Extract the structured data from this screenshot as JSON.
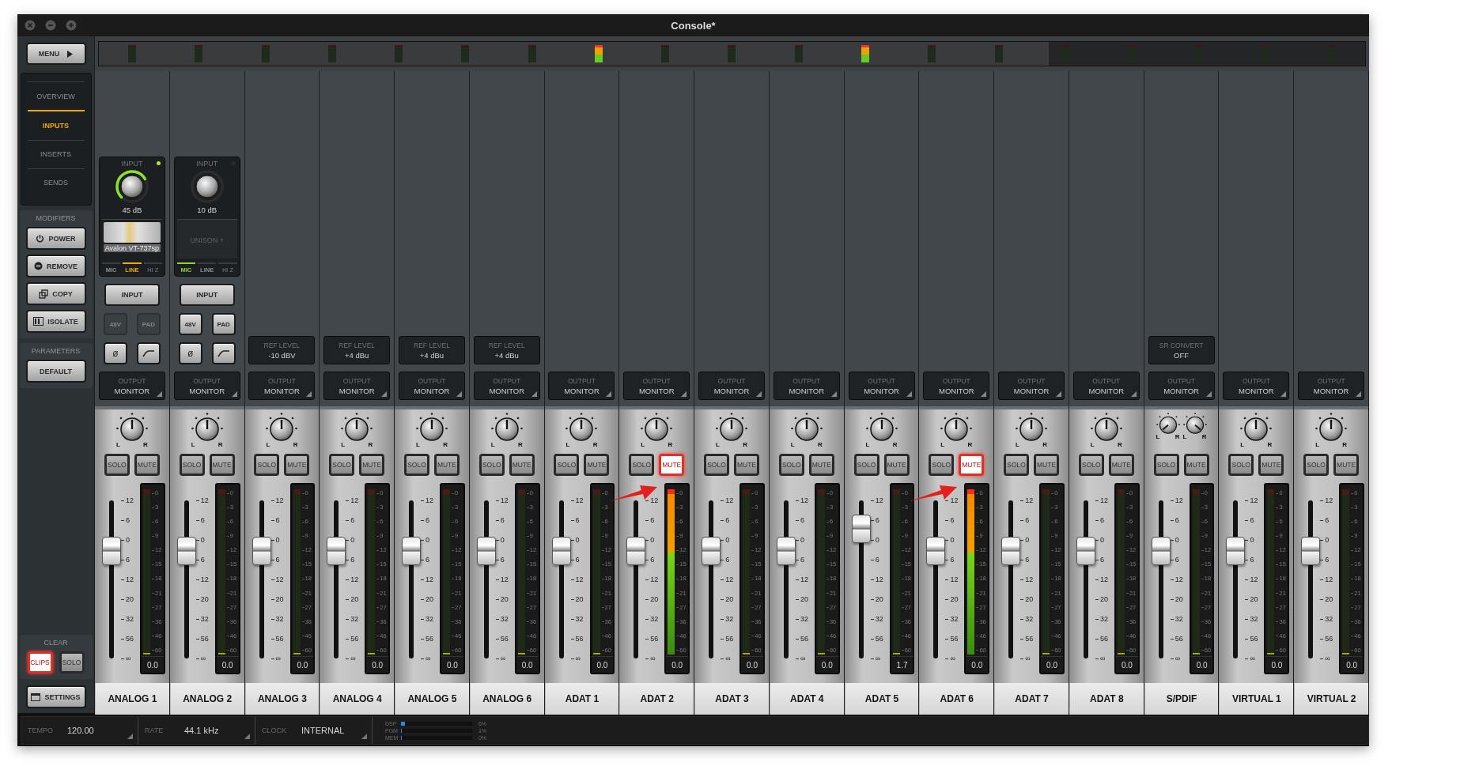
{
  "window": {
    "title": "Console*"
  },
  "overview": {
    "meters": [
      {
        "signal": false
      },
      {
        "signal": false
      },
      {
        "signal": false
      },
      {
        "signal": false
      },
      {
        "signal": false
      },
      {
        "signal": false
      },
      {
        "signal": false
      },
      {
        "signal": true
      },
      {
        "signal": false
      },
      {
        "signal": false
      },
      {
        "signal": false
      },
      {
        "signal": true
      },
      {
        "signal": false
      },
      {
        "signal": false
      },
      {
        "signal": false
      },
      {
        "signal": false
      },
      {
        "signal": false
      },
      {
        "signal": false
      },
      {
        "signal": false
      }
    ]
  },
  "sidebar": {
    "menu": "MENU",
    "nav": [
      {
        "label": "OVERVIEW",
        "selected": false
      },
      {
        "label": "INPUTS",
        "selected": true
      },
      {
        "label": "INSERTS",
        "selected": false
      },
      {
        "label": "SENDS",
        "selected": false
      }
    ],
    "modifiers_title": "MODIFIERS",
    "modifiers": [
      {
        "label": "POWER",
        "kind": "power"
      },
      {
        "label": "REMOVE",
        "kind": "remove"
      },
      {
        "label": "COPY",
        "kind": "copy"
      },
      {
        "label": "ISOLATE",
        "kind": "isolate"
      }
    ],
    "parameters_title": "PARAMETERS",
    "default": "DEFAULT",
    "clear_title": "CLEAR",
    "clear": [
      {
        "label": "CLIPS",
        "selected": true
      },
      {
        "label": "SOLO",
        "selected": false
      }
    ],
    "settings": "SETTINGS"
  },
  "channels": [
    {
      "name": "ANALOG 1",
      "input": {
        "title": "INPUT",
        "ring_lit": true,
        "led_on": true,
        "gain": "45 dB",
        "unison": {
          "kind": "loaded",
          "label": "Avalon VT-737sp"
        },
        "sources": [
          {
            "label": "MIC",
            "kind": "mic",
            "selected": false,
            "disabled": false
          },
          {
            "label": "LINE",
            "kind": "line",
            "selected": true,
            "disabled": false
          },
          {
            "label": "HI Z",
            "kind": "hiz",
            "selected": false,
            "disabled": true
          }
        ],
        "input_button": "INPUT",
        "phantom": {
          "label": "48V",
          "disabled": true
        },
        "pad": {
          "label": "PAD",
          "disabled": true
        },
        "phase": "ø"
      },
      "output": {
        "label": "OUTPUT",
        "value": "MONITOR"
      },
      "pans": [
        {
          "left": "L",
          "right": "R",
          "kind": "center"
        }
      ],
      "solo": {
        "label": "SOLO",
        "selected": false
      },
      "mute": {
        "label": "MUTE",
        "selected": false
      },
      "fader": {
        "level": 0.68
      },
      "fader_scale": [
        "12",
        "6",
        "0",
        "6",
        "12",
        "20",
        "32",
        "56",
        "∞"
      ],
      "meter": {
        "level": 0,
        "clip": false,
        "reading": "0.0"
      },
      "meter_scale": [
        "0",
        "3",
        "6",
        "9",
        "12",
        "15",
        "18",
        "21",
        "27",
        "36",
        "46",
        "60"
      ],
      "arrow": false
    },
    {
      "name": "ANALOG 2",
      "input": {
        "title": "INPUT",
        "ring_lit": false,
        "led_on": false,
        "gain": "10 dB",
        "unison": {
          "kind": "empty",
          "label": "UNISON +"
        },
        "sources": [
          {
            "label": "MIC",
            "kind": "mic",
            "selected": true,
            "disabled": false
          },
          {
            "label": "LINE",
            "kind": "line",
            "selected": false,
            "disabled": false
          },
          {
            "label": "HI Z",
            "kind": "hiz",
            "selected": false,
            "disabled": true
          }
        ],
        "input_button": "INPUT",
        "phantom": {
          "label": "48V",
          "disabled": false
        },
        "pad": {
          "label": "PAD",
          "disabled": false
        },
        "phase": "ø"
      },
      "output": {
        "label": "OUTPUT",
        "value": "MONITOR"
      },
      "pans": [
        {
          "left": "L",
          "right": "R",
          "kind": "center"
        }
      ],
      "solo": {
        "label": "SOLO",
        "selected": false
      },
      "mute": {
        "label": "MUTE",
        "selected": false
      },
      "fader": {
        "level": 0.68
      },
      "fader_scale": [
        "12",
        "6",
        "0",
        "6",
        "12",
        "20",
        "32",
        "56",
        "∞"
      ],
      "meter": {
        "level": 0,
        "clip": false,
        "reading": "0.0"
      },
      "meter_scale": [
        "0",
        "3",
        "6",
        "9",
        "12",
        "15",
        "18",
        "21",
        "27",
        "36",
        "46",
        "60"
      ],
      "arrow": false
    },
    {
      "name": "ANALOG 3",
      "setting": {
        "label": "REF LEVEL",
        "value": "-10 dBV"
      },
      "output": {
        "label": "OUTPUT",
        "value": "MONITOR"
      },
      "pans": [
        {
          "left": "L",
          "right": "R",
          "kind": "center"
        }
      ],
      "solo": {
        "label": "SOLO",
        "selected": false
      },
      "mute": {
        "label": "MUTE",
        "selected": false
      },
      "fader": {
        "level": 0.68
      },
      "fader_scale": [
        "12",
        "6",
        "0",
        "6",
        "12",
        "20",
        "32",
        "56",
        "∞"
      ],
      "meter": {
        "level": 0,
        "clip": false,
        "reading": "0.0"
      },
      "meter_scale": [
        "0",
        "3",
        "6",
        "9",
        "12",
        "15",
        "18",
        "21",
        "27",
        "36",
        "46",
        "60"
      ],
      "arrow": false
    },
    {
      "name": "ANALOG 4",
      "setting": {
        "label": "REF LEVEL",
        "value": "+4 dBu"
      },
      "output": {
        "label": "OUTPUT",
        "value": "MONITOR"
      },
      "pans": [
        {
          "left": "L",
          "right": "R",
          "kind": "center"
        }
      ],
      "solo": {
        "label": "SOLO",
        "selected": false
      },
      "mute": {
        "label": "MUTE",
        "selected": false
      },
      "fader": {
        "level": 0.68
      },
      "fader_scale": [
        "12",
        "6",
        "0",
        "6",
        "12",
        "20",
        "32",
        "56",
        "∞"
      ],
      "meter": {
        "level": 0,
        "clip": false,
        "reading": "0.0"
      },
      "meter_scale": [
        "0",
        "3",
        "6",
        "9",
        "12",
        "15",
        "18",
        "21",
        "27",
        "36",
        "46",
        "60"
      ],
      "arrow": false
    },
    {
      "name": "ANALOG 5",
      "setting": {
        "label": "REF LEVEL",
        "value": "+4 dBu"
      },
      "output": {
        "label": "OUTPUT",
        "value": "MONITOR"
      },
      "pans": [
        {
          "left": "L",
          "right": "R",
          "kind": "center"
        }
      ],
      "solo": {
        "label": "SOLO",
        "selected": false
      },
      "mute": {
        "label": "MUTE",
        "selected": false
      },
      "fader": {
        "level": 0.68
      },
      "fader_scale": [
        "12",
        "6",
        "0",
        "6",
        "12",
        "20",
        "32",
        "56",
        "∞"
      ],
      "meter": {
        "level": 0,
        "clip": false,
        "reading": "0.0"
      },
      "meter_scale": [
        "0",
        "3",
        "6",
        "9",
        "12",
        "15",
        "18",
        "21",
        "27",
        "36",
        "46",
        "60"
      ],
      "arrow": false
    },
    {
      "name": "ANALOG 6",
      "setting": {
        "label": "REF LEVEL",
        "value": "+4 dBu"
      },
      "output": {
        "label": "OUTPUT",
        "value": "MONITOR"
      },
      "pans": [
        {
          "left": "L",
          "right": "R",
          "kind": "center"
        }
      ],
      "solo": {
        "label": "SOLO",
        "selected": false
      },
      "mute": {
        "label": "MUTE",
        "selected": false
      },
      "fader": {
        "level": 0.68
      },
      "fader_scale": [
        "12",
        "6",
        "0",
        "6",
        "12",
        "20",
        "32",
        "56",
        "∞"
      ],
      "meter": {
        "level": 0,
        "clip": false,
        "reading": "0.0"
      },
      "meter_scale": [
        "0",
        "3",
        "6",
        "9",
        "12",
        "15",
        "18",
        "21",
        "27",
        "36",
        "46",
        "60"
      ],
      "arrow": false
    },
    {
      "name": "ADAT 1",
      "output": {
        "label": "OUTPUT",
        "value": "MONITOR"
      },
      "pans": [
        {
          "left": "L",
          "right": "R",
          "kind": "center"
        }
      ],
      "solo": {
        "label": "SOLO",
        "selected": false
      },
      "mute": {
        "label": "MUTE",
        "selected": false
      },
      "fader": {
        "level": 0.68
      },
      "fader_scale": [
        "12",
        "6",
        "0",
        "6",
        "12",
        "20",
        "32",
        "56",
        "∞"
      ],
      "meter": {
        "level": 0,
        "clip": false,
        "reading": "0.0"
      },
      "meter_scale": [
        "0",
        "3",
        "6",
        "9",
        "12",
        "15",
        "18",
        "21",
        "27",
        "36",
        "46",
        "60"
      ],
      "arrow": false
    },
    {
      "name": "ADAT 2",
      "output": {
        "label": "OUTPUT",
        "value": "MONITOR"
      },
      "pans": [
        {
          "left": "L",
          "right": "R",
          "kind": "center"
        }
      ],
      "solo": {
        "label": "SOLO",
        "selected": false
      },
      "mute": {
        "label": "MUTE",
        "selected": true
      },
      "fader": {
        "level": 0.68
      },
      "fader_scale": [
        "12",
        "6",
        "0",
        "6",
        "12",
        "20",
        "32",
        "56",
        "∞"
      ],
      "meter": {
        "level": 0.98,
        "clip": true,
        "reading": "0.0"
      },
      "meter_scale": [
        "0",
        "3",
        "6",
        "9",
        "12",
        "15",
        "18",
        "21",
        "27",
        "36",
        "46",
        "60"
      ],
      "arrow": true
    },
    {
      "name": "ADAT 3",
      "output": {
        "label": "OUTPUT",
        "value": "MONITOR"
      },
      "pans": [
        {
          "left": "L",
          "right": "R",
          "kind": "center"
        }
      ],
      "solo": {
        "label": "SOLO",
        "selected": false
      },
      "mute": {
        "label": "MUTE",
        "selected": false
      },
      "fader": {
        "level": 0.68
      },
      "fader_scale": [
        "12",
        "6",
        "0",
        "6",
        "12",
        "20",
        "32",
        "56",
        "∞"
      ],
      "meter": {
        "level": 0,
        "clip": false,
        "reading": "0.0"
      },
      "meter_scale": [
        "0",
        "3",
        "6",
        "9",
        "12",
        "15",
        "18",
        "21",
        "27",
        "36",
        "46",
        "60"
      ],
      "arrow": false
    },
    {
      "name": "ADAT 4",
      "output": {
        "label": "OUTPUT",
        "value": "MONITOR"
      },
      "pans": [
        {
          "left": "L",
          "right": "R",
          "kind": "center"
        }
      ],
      "solo": {
        "label": "SOLO",
        "selected": false
      },
      "mute": {
        "label": "MUTE",
        "selected": false
      },
      "fader": {
        "level": 0.68
      },
      "fader_scale": [
        "12",
        "6",
        "0",
        "6",
        "12",
        "20",
        "32",
        "56",
        "∞"
      ],
      "meter": {
        "level": 0,
        "clip": false,
        "reading": "0.0"
      },
      "meter_scale": [
        "0",
        "3",
        "6",
        "9",
        "12",
        "15",
        "18",
        "21",
        "27",
        "36",
        "46",
        "60"
      ],
      "arrow": false
    },
    {
      "name": "ADAT 5",
      "output": {
        "label": "OUTPUT",
        "value": "MONITOR"
      },
      "pans": [
        {
          "left": "L",
          "right": "R",
          "kind": "center"
        }
      ],
      "solo": {
        "label": "SOLO",
        "selected": false
      },
      "mute": {
        "label": "MUTE",
        "selected": false
      },
      "fader": {
        "level": 0.82
      },
      "fader_scale": [
        "12",
        "6",
        "0",
        "6",
        "12",
        "20",
        "32",
        "56",
        "∞"
      ],
      "meter": {
        "level": 0,
        "clip": false,
        "reading": "1.7"
      },
      "meter_scale": [
        "0",
        "3",
        "6",
        "9",
        "12",
        "15",
        "18",
        "21",
        "27",
        "36",
        "46",
        "60"
      ],
      "arrow": false
    },
    {
      "name": "ADAT 6",
      "output": {
        "label": "OUTPUT",
        "value": "MONITOR"
      },
      "pans": [
        {
          "left": "L",
          "right": "R",
          "kind": "center"
        }
      ],
      "solo": {
        "label": "SOLO",
        "selected": false
      },
      "mute": {
        "label": "MUTE",
        "selected": true
      },
      "fader": {
        "level": 0.68
      },
      "fader_scale": [
        "12",
        "6",
        "0",
        "6",
        "12",
        "20",
        "32",
        "56",
        "∞"
      ],
      "meter": {
        "level": 0.98,
        "clip": true,
        "reading": "0.0"
      },
      "meter_scale": [
        "0",
        "3",
        "6",
        "9",
        "12",
        "15",
        "18",
        "21",
        "27",
        "36",
        "46",
        "60"
      ],
      "arrow": true
    },
    {
      "name": "ADAT 7",
      "output": {
        "label": "OUTPUT",
        "value": "MONITOR"
      },
      "pans": [
        {
          "left": "L",
          "right": "R",
          "kind": "center"
        }
      ],
      "solo": {
        "label": "SOLO",
        "selected": false
      },
      "mute": {
        "label": "MUTE",
        "selected": false
      },
      "fader": {
        "level": 0.68
      },
      "fader_scale": [
        "12",
        "6",
        "0",
        "6",
        "12",
        "20",
        "32",
        "56",
        "∞"
      ],
      "meter": {
        "level": 0,
        "clip": false,
        "reading": "0.0"
      },
      "meter_scale": [
        "0",
        "3",
        "6",
        "9",
        "12",
        "15",
        "18",
        "21",
        "27",
        "36",
        "46",
        "60"
      ],
      "arrow": false
    },
    {
      "name": "ADAT 8",
      "output": {
        "label": "OUTPUT",
        "value": "MONITOR"
      },
      "pans": [
        {
          "left": "L",
          "right": "R",
          "kind": "center"
        }
      ],
      "solo": {
        "label": "SOLO",
        "selected": false
      },
      "mute": {
        "label": "MUTE",
        "selected": false
      },
      "fader": {
        "level": 0.68
      },
      "fader_scale": [
        "12",
        "6",
        "0",
        "6",
        "12",
        "20",
        "32",
        "56",
        "∞"
      ],
      "meter": {
        "level": 0,
        "clip": false,
        "reading": "0.0"
      },
      "meter_scale": [
        "0",
        "3",
        "6",
        "9",
        "12",
        "15",
        "18",
        "21",
        "27",
        "36",
        "46",
        "60"
      ],
      "arrow": false
    },
    {
      "name": "S/PDIF",
      "setting": {
        "label": "SR CONVERT",
        "value": "OFF"
      },
      "output": {
        "label": "OUTPUT",
        "value": "MONITOR"
      },
      "pans": [
        {
          "left": "L",
          "right": "R",
          "kind": "left"
        },
        {
          "left": "L",
          "right": "R",
          "kind": "right"
        }
      ],
      "solo": {
        "label": "SOLO",
        "selected": false
      },
      "mute": {
        "label": "MUTE",
        "selected": false
      },
      "fader": {
        "level": 0.68
      },
      "fader_scale": [
        "12",
        "6",
        "0",
        "6",
        "12",
        "20",
        "32",
        "56",
        "∞"
      ],
      "meter": {
        "level": 0,
        "clip": false,
        "reading": "0.0"
      },
      "meter_scale": [
        "0",
        "3",
        "6",
        "9",
        "12",
        "15",
        "18",
        "21",
        "27",
        "36",
        "46",
        "60"
      ],
      "arrow": false
    },
    {
      "name": "VIRTUAL 1",
      "output": {
        "label": "OUTPUT",
        "value": "MONITOR"
      },
      "pans": [
        {
          "left": "L",
          "right": "R",
          "kind": "center"
        }
      ],
      "solo": {
        "label": "SOLO",
        "selected": false
      },
      "mute": {
        "label": "MUTE",
        "selected": false
      },
      "fader": {
        "level": 0.68
      },
      "fader_scale": [
        "12",
        "6",
        "0",
        "6",
        "12",
        "20",
        "32",
        "56",
        "∞"
      ],
      "meter": {
        "level": 0,
        "clip": false,
        "reading": "0.0"
      },
      "meter_scale": [
        "0",
        "3",
        "6",
        "9",
        "12",
        "15",
        "18",
        "21",
        "27",
        "36",
        "46",
        "60"
      ],
      "arrow": false
    },
    {
      "name": "VIRTUAL 2",
      "output": {
        "label": "OUTPUT",
        "value": "MONITOR"
      },
      "pans": [
        {
          "left": "L",
          "right": "R",
          "kind": "center"
        }
      ],
      "solo": {
        "label": "SOLO",
        "selected": false
      },
      "mute": {
        "label": "MUTE",
        "selected": false
      },
      "fader": {
        "level": 0.68
      },
      "fader_scale": [
        "12",
        "6",
        "0",
        "6",
        "12",
        "20",
        "32",
        "56",
        "∞"
      ],
      "meter": {
        "level": 0,
        "clip": false,
        "reading": "0.0"
      },
      "meter_scale": [
        "0",
        "3",
        "6",
        "9",
        "12",
        "15",
        "18",
        "21",
        "27",
        "36",
        "46",
        "60"
      ],
      "arrow": false
    }
  ],
  "status_bar": {
    "fields": [
      {
        "label": "TEMPO",
        "value": "120.00"
      },
      {
        "label": "RATE",
        "value": "44.1 kHz"
      },
      {
        "label": "CLOCK",
        "value": "INTERNAL"
      }
    ],
    "meters": [
      {
        "label": "DSP",
        "level": 0.06,
        "reading": "6%"
      },
      {
        "label": "PGM",
        "level": 0.01,
        "reading": "1%"
      },
      {
        "label": "MEM",
        "level": 0,
        "reading": "0%"
      }
    ]
  }
}
